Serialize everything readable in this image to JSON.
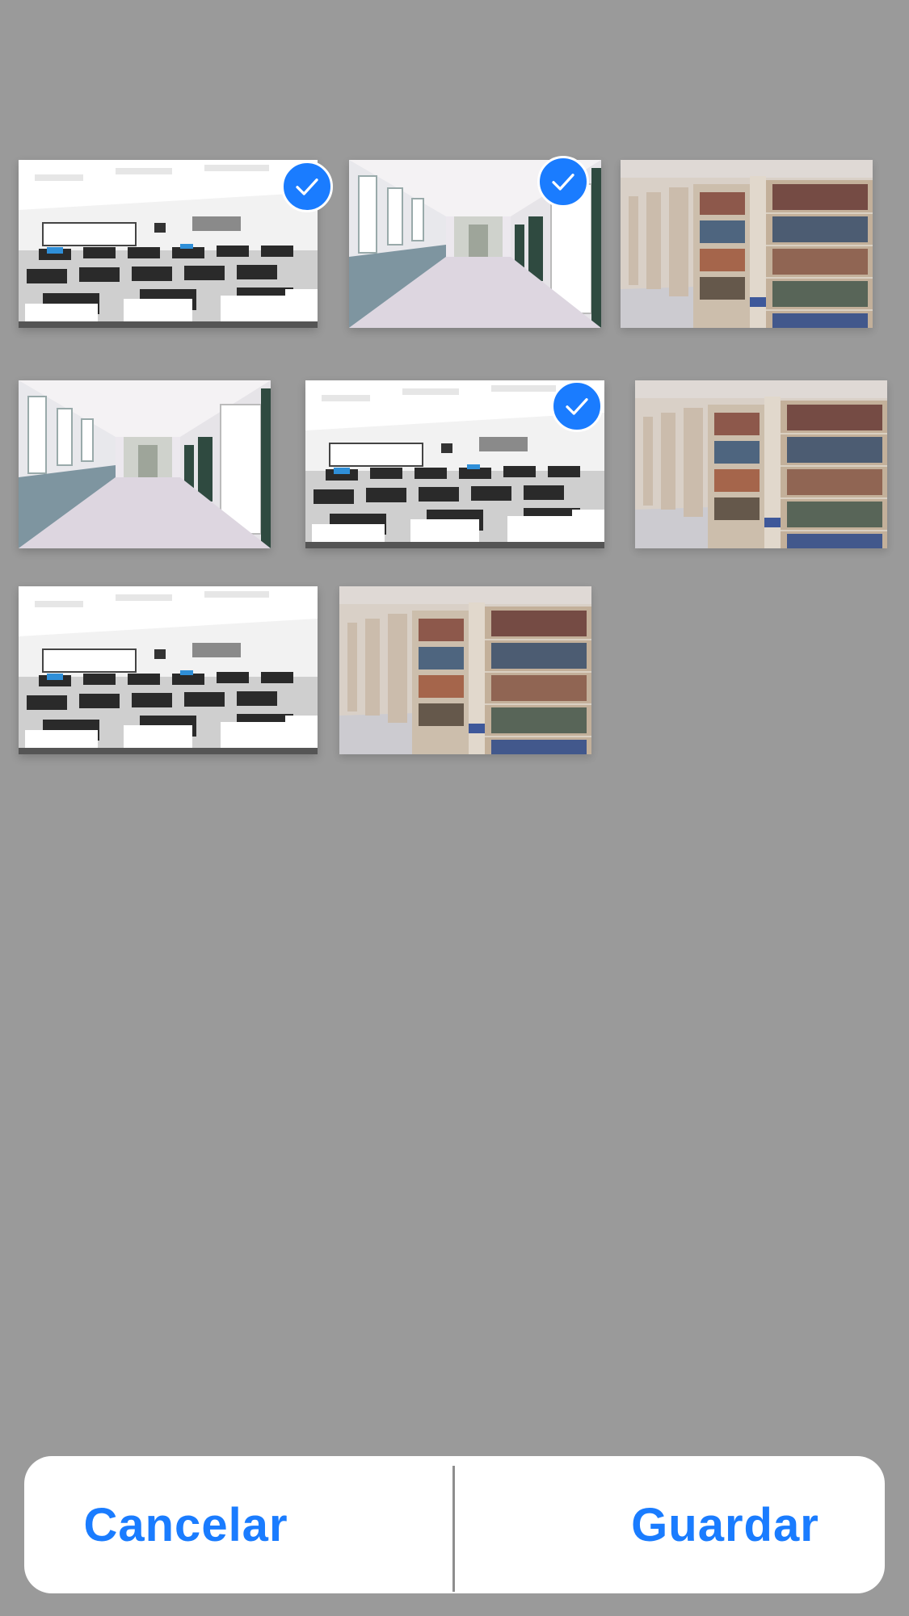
{
  "colors": {
    "background": "#9a9a9a",
    "accent": "#1a7cff",
    "sheet": "#ffffff"
  },
  "photos": [
    {
      "scene": "classroom",
      "selected": true
    },
    {
      "scene": "hallway",
      "selected": true
    },
    {
      "scene": "library",
      "selected": false
    },
    {
      "scene": "hallway",
      "selected": false
    },
    {
      "scene": "classroom",
      "selected": true
    },
    {
      "scene": "library",
      "selected": false
    },
    {
      "scene": "classroom",
      "selected": false
    },
    {
      "scene": "library",
      "selected": false
    }
  ],
  "icons": {
    "selected": "checkmark-icon"
  },
  "actions": {
    "cancel_label": "Cancelar",
    "save_label": "Guardar"
  }
}
